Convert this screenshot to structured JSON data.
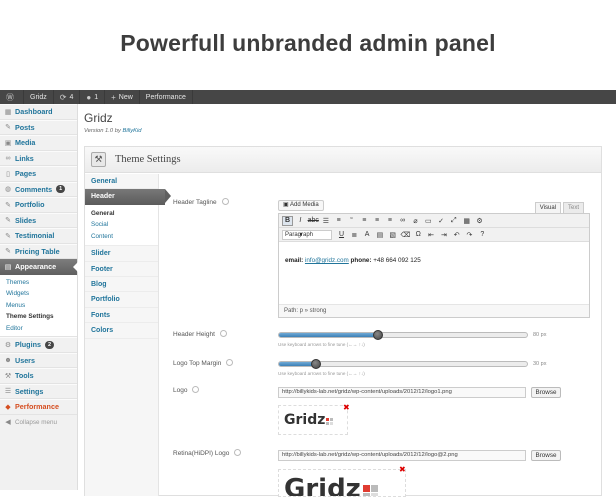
{
  "banner": {
    "title": "Powerfull unbranded admin panel"
  },
  "adminbar": {
    "wp_icon": "wordpress-icon",
    "site": "Gridz",
    "updates": "4",
    "comments": "1",
    "new": "New",
    "performance": "Performance"
  },
  "sidebar": {
    "dashboard": "Dashboard",
    "posts": "Posts",
    "media": "Media",
    "links": "Links",
    "pages": "Pages",
    "comments": "Comments",
    "comments_count": "1",
    "portfolio": "Portfolio",
    "slides": "Slides",
    "testimonial": "Testimonial",
    "pricing_table": "Pricing Table",
    "appearance": "Appearance",
    "appearance_sub": [
      "Themes",
      "Widgets",
      "Menus",
      "Theme Settings",
      "Editor"
    ],
    "plugins": "Plugins",
    "plugins_count": "2",
    "users": "Users",
    "tools": "Tools",
    "settings": "Settings",
    "performance": "Performance",
    "collapse": "Collapse menu"
  },
  "page": {
    "title": "Gridz",
    "version_prefix": "Version 1.0 by",
    "author": "BillyKid",
    "panel_title": "Theme Settings"
  },
  "tabs": {
    "general": "General",
    "header": "Header",
    "header_sub": [
      "General",
      "Social",
      "Content"
    ],
    "slider": "Slider",
    "footer": "Footer",
    "blog": "Blog",
    "portfolio": "Portfolio",
    "fonts": "Fonts",
    "colors": "Colors"
  },
  "fields": {
    "header_tagline": "Header Tagline",
    "add_media": "Add Media",
    "visual": "Visual",
    "text": "Text",
    "format": "Paragraph",
    "tagline_email_label": "email:",
    "tagline_email": "info@gridz.com",
    "tagline_phone_label": "phone:",
    "tagline_phone": "+48 664 092 125",
    "path": "Path: p » strong",
    "header_height": "Header Height",
    "header_height_value": "80 px",
    "header_height_level": 0.4,
    "hint": "Use keyboard arrows to fine tune (←→ ↑↓)",
    "logo_top_margin": "Logo Top Margin",
    "logo_top_margin_value": "30 px",
    "logo_top_margin_level": 0.15,
    "logo": "Logo",
    "logo_url": "http://billykids-lab.net/gridz/wp-content/uploads/2012/12/logo1.png",
    "browse": "Browse",
    "logo_text": "Gridz",
    "retina_logo": "Retina(HiDPI) Logo",
    "retina_url": "http://billykids-lab.net/gridz/wp-content/uploads/2012/12/logo@2.png",
    "retina_logo_text": "Gridz"
  },
  "colors": {
    "accent": "#21759b",
    "adminbar": "#464646",
    "slider_fill": "#3d80b6",
    "logo_accent": "#e03c31"
  }
}
